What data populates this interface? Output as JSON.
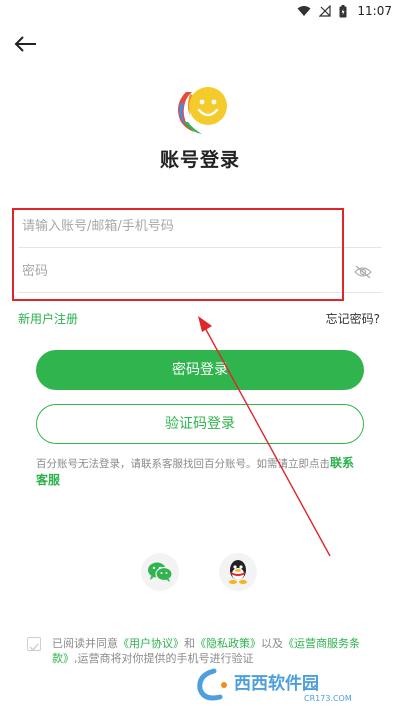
{
  "status_bar": {
    "time": "11:07"
  },
  "logo": {
    "alt": "百分 logo"
  },
  "title": "账号登录",
  "form": {
    "account_placeholder": "请输入账号/邮箱/手机号码",
    "password_placeholder": "密码"
  },
  "links": {
    "register": "新用户注册",
    "forgot": "忘记密码?"
  },
  "buttons": {
    "password_login": "密码登录",
    "code_login": "验证码登录"
  },
  "notice": {
    "text": "百分账号无法登录，请联系客服找回百分账号。如需请立即点击",
    "cs_link": "联系客服"
  },
  "agreement": {
    "prefix": "已阅读并同意",
    "user_agreement": "《用户协议》",
    "and": "和",
    "privacy_policy": "《隐私政策》",
    "also": "以及",
    "carrier_terms": "《运营商服务条款》",
    "suffix": ",运营商将对你提供的手机号进行验证"
  },
  "watermark": {
    "brand": "西西软件园",
    "url": "CR173.COM"
  },
  "colors": {
    "accent": "#2fb44e",
    "highlight": "#e0262a"
  }
}
